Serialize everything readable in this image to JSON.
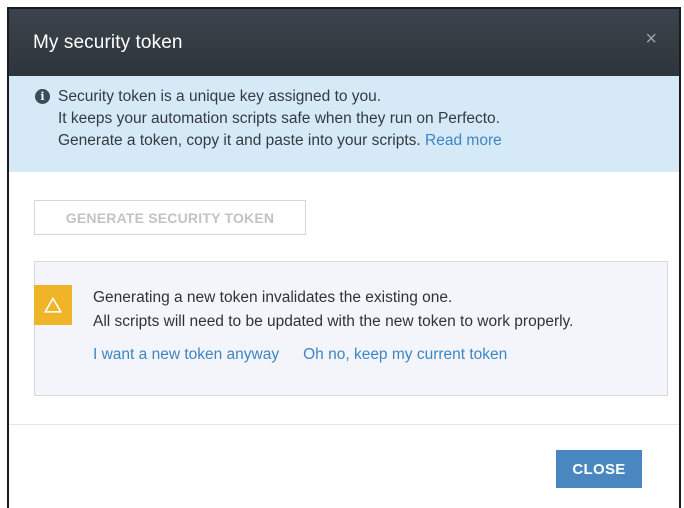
{
  "dialog": {
    "title": "My security token",
    "close_icon": "×"
  },
  "info": {
    "icon": "i",
    "lines": [
      "Security token is a unique key assigned to you.",
      "It keeps your automation scripts safe when they run on Perfecto.",
      "Generate a token, copy it and paste into your scripts."
    ],
    "read_more": "Read more"
  },
  "generate_button": "GENERATE SECURITY TOKEN",
  "warning": {
    "icon": "warning-triangle",
    "lines": [
      "Generating a new token invalidates the existing one.",
      "All scripts will need to be updated with the new token to work properly."
    ],
    "confirm_link": "I want a new token anyway",
    "cancel_link": "Oh no, keep my current token"
  },
  "footer": {
    "close_button": "CLOSE"
  },
  "colors": {
    "header_bg": "#333b42",
    "info_bg": "#d6e9f7",
    "link": "#3c86c4",
    "warning_icon_bg": "#f0b429",
    "primary_button": "#4a87c1"
  }
}
